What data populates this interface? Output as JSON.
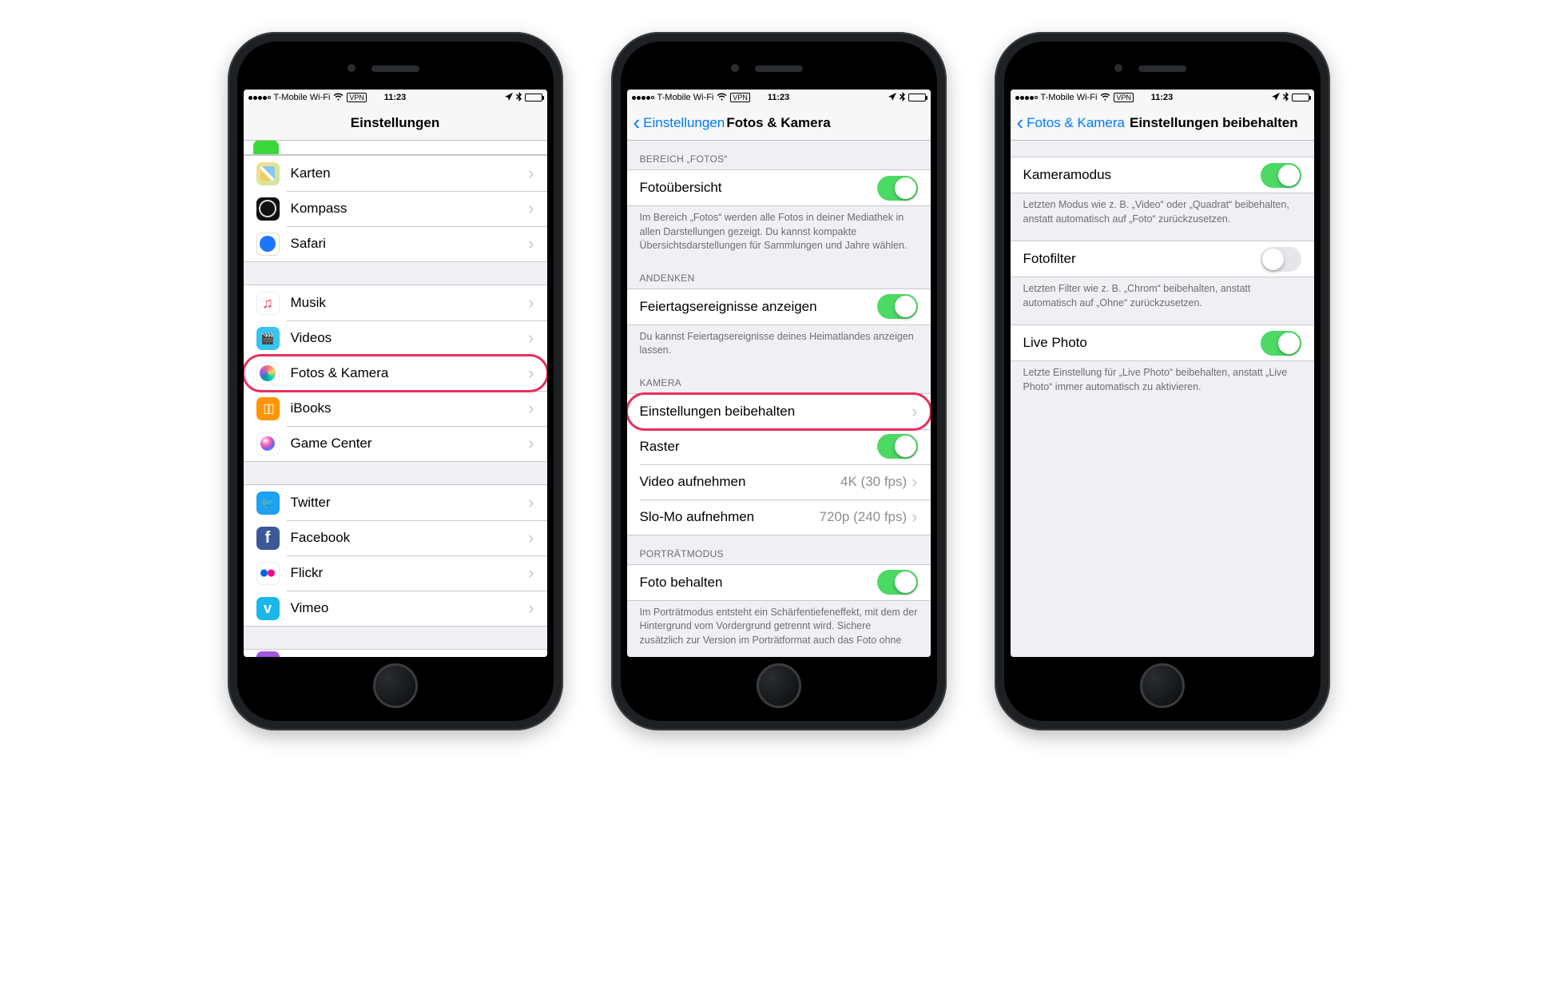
{
  "status": {
    "carrier": "T-Mobile Wi-Fi",
    "vpn": "VPN",
    "time": "11:23"
  },
  "phone1": {
    "nav_title": "Einstellungen",
    "groups": [
      {
        "rows": [
          {
            "icon": "ic-maps",
            "name": "row-karten",
            "label": "Karten"
          },
          {
            "icon": "ic-compass",
            "name": "row-kompass",
            "label": "Kompass"
          },
          {
            "icon": "ic-safari",
            "name": "row-safari",
            "label": "Safari"
          }
        ]
      },
      {
        "rows": [
          {
            "icon": "ic-music",
            "name": "row-musik",
            "label": "Musik"
          },
          {
            "icon": "ic-videos",
            "name": "row-videos",
            "label": "Videos"
          },
          {
            "icon": "ic-photos",
            "name": "row-fotos",
            "label": "Fotos & Kamera",
            "highlight": true
          },
          {
            "icon": "ic-ibooks",
            "name": "row-ibooks",
            "label": "iBooks"
          },
          {
            "icon": "ic-gc",
            "name": "row-gamecenter",
            "label": "Game Center"
          }
        ]
      },
      {
        "rows": [
          {
            "icon": "ic-twitter",
            "name": "row-twitter",
            "label": "Twitter"
          },
          {
            "icon": "ic-facebook",
            "name": "row-facebook",
            "label": "Facebook"
          },
          {
            "icon": "ic-flickr",
            "name": "row-flickr",
            "label": "Flickr"
          },
          {
            "icon": "ic-vimeo",
            "name": "row-vimeo",
            "label": "Vimeo"
          }
        ]
      }
    ]
  },
  "phone2": {
    "back": "Einstellungen",
    "title": "Fotos & Kamera",
    "sections": [
      {
        "header": "BEREICH „FOTOS“",
        "rows": [
          {
            "name": "row-fotouebersicht",
            "label": "Fotoübersicht",
            "switch": true,
            "on": true
          }
        ],
        "footer": "Im Bereich „Fotos“ werden alle Fotos in deiner Mediathek in allen Darstellungen gezeigt. Du kannst kompakte Übersichtsdarstellungen für Sammlungen und Jahre wählen."
      },
      {
        "header": "ANDENKEN",
        "rows": [
          {
            "name": "row-feiertagsereignisse",
            "label": "Feiertagsereignisse anzeigen",
            "switch": true,
            "on": true
          }
        ],
        "footer": "Du kannst Feiertagsereignisse deines Heimatlandes anzeigen lassen."
      },
      {
        "header": "KAMERA",
        "rows": [
          {
            "name": "row-einstellungen-beibehalten",
            "label": "Einstellungen beibehalten",
            "chev": true,
            "highlight": true
          },
          {
            "name": "row-raster",
            "label": "Raster",
            "switch": true,
            "on": true
          },
          {
            "name": "row-video",
            "label": "Video aufnehmen",
            "detail": "4K (30 fps)",
            "chev": true
          },
          {
            "name": "row-slomo",
            "label": "Slo-Mo aufnehmen",
            "detail": "720p (240 fps)",
            "chev": true
          }
        ]
      },
      {
        "header": "PORTRÄTMODUS",
        "rows": [
          {
            "name": "row-foto-behalten",
            "label": "Foto behalten",
            "switch": true,
            "on": true
          }
        ],
        "footer": "Im Porträtmodus entsteht ein Schärfentiefeneffekt, mit dem der Hintergrund vom Vordergrund getrennt wird. Sichere zusätzlich zur Version im Porträtformat auch das Foto ohne"
      }
    ]
  },
  "phone3": {
    "back": "Fotos & Kamera",
    "title": "Einstellungen beibehalten",
    "sections": [
      {
        "rows": [
          {
            "name": "row-kameramodus",
            "label": "Kameramodus",
            "switch": true,
            "on": true
          }
        ],
        "footer": "Letzten Modus wie z. B. „Video“ oder „Quadrat“ beibehalten, anstatt automatisch auf „Foto“ zurückzusetzen."
      },
      {
        "rows": [
          {
            "name": "row-fotofilter",
            "label": "Fotofilter",
            "switch": true,
            "on": false
          }
        ],
        "footer": "Letzten Filter wie z. B. „Chrom“ beibehalten, anstatt automatisch auf „Ohne“ zurückzusetzen."
      },
      {
        "rows": [
          {
            "name": "row-livephoto",
            "label": "Live Photo",
            "switch": true,
            "on": true
          }
        ],
        "footer": "Letzte Einstellung für „Live Photo“ beibehalten, anstatt „Live Photo“ immer automatisch zu aktivieren."
      }
    ]
  }
}
